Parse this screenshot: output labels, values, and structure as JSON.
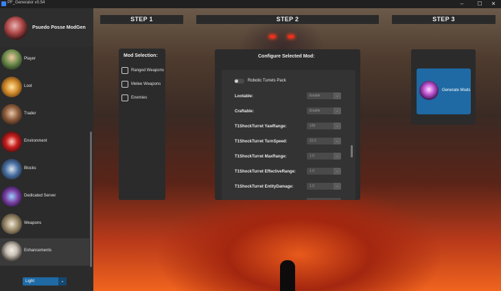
{
  "window": {
    "title": "PF_Generator v0.54",
    "controls": {
      "minimize": "–",
      "maximize": "☐",
      "close": "✕"
    }
  },
  "sidebar": {
    "app_name": "Psuedo Posse ModGen",
    "items": [
      {
        "label": "Player",
        "icon": "player-avatar",
        "color": "#3f6b3a"
      },
      {
        "label": "Loot",
        "icon": "loot-avatar",
        "color": "#d08a2c"
      },
      {
        "label": "Trader",
        "icon": "trader-avatar",
        "color": "#8a5a3a"
      },
      {
        "label": "Environment",
        "icon": "environment-avatar",
        "color": "#b31d1d"
      },
      {
        "label": "Blocks",
        "icon": "blocks-avatar",
        "color": "#4a6fa0"
      },
      {
        "label": "Dedicated Server",
        "icon": "server-avatar",
        "color": "#7a3fa0"
      },
      {
        "label": "Weapons",
        "icon": "weapons-avatar",
        "color": "#9a8a6a"
      },
      {
        "label": "Enhancements",
        "icon": "enhancements-avatar",
        "color": "#c8c0b4"
      }
    ],
    "active_index": 7,
    "theme_select": {
      "value": "Light",
      "arrow": "⌄"
    }
  },
  "steps": {
    "step1": "STEP 1",
    "step2": "STEP 2",
    "step3": "STEP 3"
  },
  "mod_selection": {
    "title": "Mod Selection:",
    "options": [
      {
        "label": "Ranged Weapons",
        "checked": false
      },
      {
        "label": "Melee Weapons",
        "checked": false
      },
      {
        "label": "Enemies",
        "checked": false
      }
    ]
  },
  "configure": {
    "title": "Configure Selected Mod:",
    "toggle_label": "Robotic Turrets Pack",
    "toggle_on": false,
    "rows": [
      {
        "label": "Lootable:",
        "value": "Enable"
      },
      {
        "label": "Craftable:",
        "value": "Enable"
      },
      {
        "label": "T1ShockTurret YawRange:",
        "value": "135"
      },
      {
        "label": "T1ShockTurret TurnSpeed:",
        "value": "22.5"
      },
      {
        "label": "T1ShockTurret MaxRange:",
        "value": "1.0"
      },
      {
        "label": "T1ShockTurret EffectiveRange:",
        "value": "1.0"
      },
      {
        "label": "T1ShockTurret EntityDamage:",
        "value": "1.0"
      }
    ]
  },
  "generate": {
    "label": "Generate Mods"
  },
  "colors": {
    "accent": "#1f6aa5",
    "panel": "#2b2b2b",
    "sidebar": "#2b2b2b"
  }
}
